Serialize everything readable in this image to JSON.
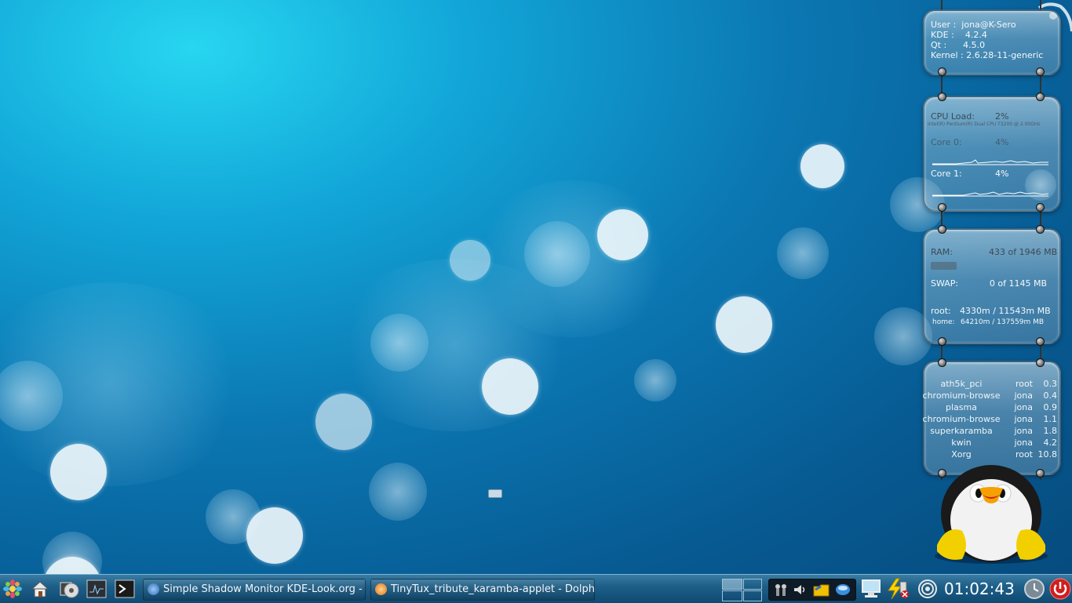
{
  "system_info": {
    "user_label": "User :",
    "user_value": "jona@K-Sero",
    "kde_label": "KDE :",
    "kde_value": "4.2.4",
    "qt_label": "Qt :",
    "qt_value": "4.5.0",
    "kernel_label": "Kernel :",
    "kernel_value": "2.6.28-11-generic"
  },
  "cpu": {
    "load_label": "CPU Load:",
    "load_value": "2%",
    "model": "Intel(R) Pentium(R) Dual  CPU  T3200  @ 2.00GHz",
    "core0_label": "Core 0:",
    "core0_value": "4%",
    "core1_label": "Core 1:",
    "core1_value": "4%"
  },
  "memory": {
    "ram_label": "RAM:",
    "ram_value": "433 of 1946 MB",
    "ram_fraction": 0.22,
    "swap_label": "SWAP:",
    "swap_value": "0 of 1145 MB",
    "root_label": "root:",
    "root_value": "4330m / 11543m MB",
    "home_label": "home:",
    "home_value": "64210m / 137559m MB"
  },
  "processes": [
    {
      "name": "ath5k_pci",
      "user": "root",
      "cpu": "0.3"
    },
    {
      "name": "chromium-browse",
      "user": "jona",
      "cpu": "0.4"
    },
    {
      "name": "plasma",
      "user": "jona",
      "cpu": "0.9"
    },
    {
      "name": "chromium-browse",
      "user": "jona",
      "cpu": "1.1"
    },
    {
      "name": "superkaramba",
      "user": "jona",
      "cpu": "1.8"
    },
    {
      "name": "kwin",
      "user": "jona",
      "cpu": "4.2"
    },
    {
      "name": "Xorg",
      "user": "root",
      "cpu": "10.8"
    }
  ],
  "taskbar": {
    "launchers": [
      "kde-menu-icon",
      "home-folder-icon",
      "disc-burner-icon",
      "system-monitor-icon",
      "terminal-icon"
    ],
    "tasks": [
      {
        "label": "Simple Shadow Monitor KDE-Look.org -",
        "icon": "konqueror-icon"
      },
      {
        "label": "TinyTux_tribute_karamba-applet - Dolph",
        "icon": "dolphin-icon"
      }
    ],
    "tray_icons": [
      "network-icon",
      "volume-icon",
      "folder-icon",
      "kopete-icon",
      "display-icon",
      "battery-power-icon",
      "wireless-icon"
    ],
    "clock": "01:02:43"
  },
  "colors": {
    "panel": "#1d5f88",
    "desktop_accent": "#27d6f0"
  }
}
